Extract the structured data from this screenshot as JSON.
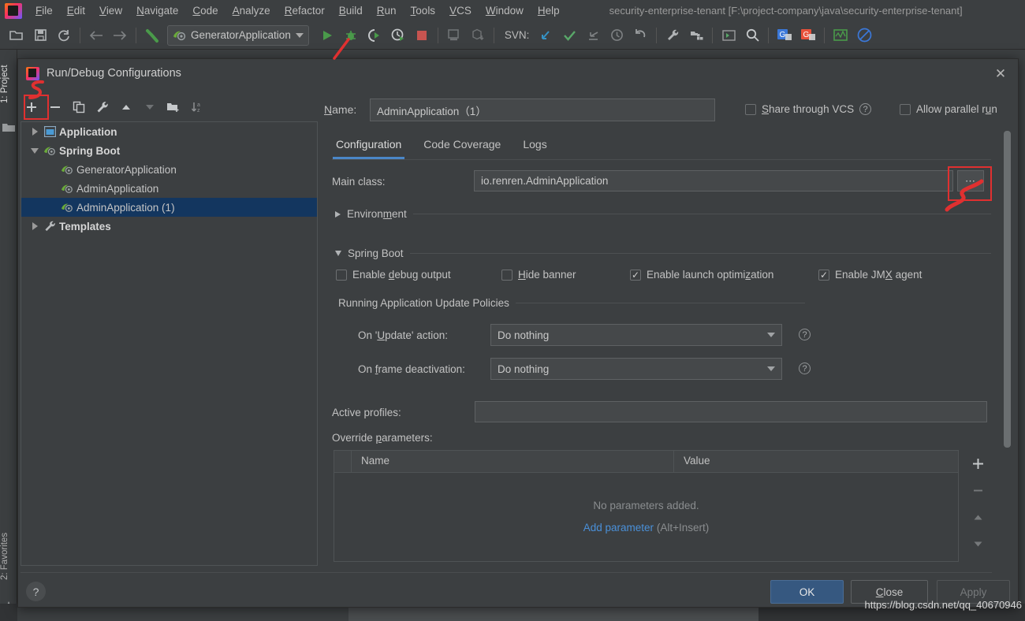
{
  "ide": {
    "menu": [
      {
        "label": "File",
        "accel": "F"
      },
      {
        "label": "Edit",
        "accel": "E"
      },
      {
        "label": "View",
        "accel": "V"
      },
      {
        "label": "Navigate",
        "accel": "N"
      },
      {
        "label": "Code",
        "accel": "C"
      },
      {
        "label": "Analyze",
        "accel": "A"
      },
      {
        "label": "Refactor",
        "accel": "R"
      },
      {
        "label": "Build",
        "accel": "B"
      },
      {
        "label": "Run",
        "accel": "R"
      },
      {
        "label": "Tools",
        "accel": "T"
      },
      {
        "label": "VCS",
        "accel": "V"
      },
      {
        "label": "Window",
        "accel": "W"
      },
      {
        "label": "Help",
        "accel": "H"
      }
    ],
    "project_title": "security-enterprise-tenant [F:\\project-company\\java\\security-enterprise-tenant]",
    "toolbar": {
      "run_configuration": "GeneratorApplication",
      "vcs_label": "SVN:"
    },
    "tool_windows": {
      "project": "1: Project",
      "favorites": "2: Favorites"
    }
  },
  "dialog": {
    "title": "Run/Debug Configurations",
    "close_label": "✕",
    "left_toolbar": [
      {
        "name": "add",
        "glyph": "+"
      },
      {
        "name": "remove",
        "glyph": "−"
      },
      {
        "name": "copy",
        "glyph": "copy"
      },
      {
        "name": "edit-templates",
        "glyph": "wrench"
      },
      {
        "name": "move-up",
        "glyph": "▲"
      },
      {
        "name": "move-down",
        "glyph": "▼"
      },
      {
        "name": "create-folder",
        "glyph": "folder-plus"
      },
      {
        "name": "sort",
        "glyph": "sort-az"
      }
    ],
    "tree": [
      {
        "label": "Application",
        "level": 0,
        "twisty": "right",
        "icon": "application",
        "bold": true,
        "selected": false
      },
      {
        "label": "Spring Boot",
        "level": 0,
        "twisty": "down",
        "icon": "spring",
        "bold": true,
        "selected": false
      },
      {
        "label": "GeneratorApplication",
        "level": 1,
        "twisty": "none",
        "icon": "spring",
        "bold": false,
        "selected": false
      },
      {
        "label": "AdminApplication",
        "level": 1,
        "twisty": "none",
        "icon": "spring",
        "bold": false,
        "selected": false
      },
      {
        "label": "AdminApplication  (1)",
        "level": 1,
        "twisty": "none",
        "icon": "spring",
        "bold": false,
        "selected": true
      },
      {
        "label": "Templates",
        "level": 0,
        "twisty": "right",
        "icon": "wrench",
        "bold": true,
        "selected": false
      }
    ],
    "name_label": "Name:",
    "name_accel": "N",
    "name_value": "AdminApplication（1）",
    "share_vcs": {
      "label": "Share through VCS",
      "accel": "S",
      "checked": false
    },
    "allow_parallel": {
      "label": "Allow parallel run",
      "accel": "u",
      "checked": false
    },
    "tabs": [
      {
        "label": "Configuration",
        "active": true
      },
      {
        "label": "Code Coverage",
        "active": false
      },
      {
        "label": "Logs",
        "active": false
      }
    ],
    "main_class": {
      "label": "Main class:",
      "value": "io.renren.AdminApplication",
      "browse_glyph": "⋯"
    },
    "environment_section": {
      "label": "Environment",
      "accel": "m",
      "expanded": false
    },
    "spring_boot_section": {
      "label": "Spring Boot",
      "accel": "g",
      "expanded": true
    },
    "spring_checkboxes": [
      {
        "label": "Enable debug output",
        "accel": "d",
        "checked": false
      },
      {
        "label": "Hide banner",
        "accel": "H",
        "checked": false
      },
      {
        "label": "Enable launch optimization",
        "accel": "z",
        "checked": true
      },
      {
        "label": "Enable JMX agent",
        "accel": "X",
        "checked": true
      }
    ],
    "update_policies_label": "Running Application Update Policies",
    "on_update_action": {
      "label": "On 'Update' action:",
      "accel": "U",
      "value": "Do nothing"
    },
    "on_frame_deactivation": {
      "label": "On frame deactivation:",
      "accel": "f",
      "value": "Do nothing"
    },
    "active_profiles": {
      "label": "Active profiles:",
      "value": ""
    },
    "override_parameters": {
      "label": "Override parameters:",
      "accel": "p",
      "columns": [
        "Name",
        "Value"
      ],
      "rows": [],
      "empty_message": "No parameters added.",
      "add_link": "Add parameter",
      "add_hint": "(Alt+Insert)",
      "side_buttons": [
        "+",
        "−",
        "▲",
        "▼"
      ]
    },
    "footer": {
      "help_glyph": "?",
      "ok": "OK",
      "close": "Close",
      "close_accel": "C",
      "apply": "Apply"
    }
  },
  "watermark": "https://blog.csdn.net/qq_40670946",
  "colors": {
    "accent_blue": "#4b87c8",
    "selection_blue": "#13365f",
    "primary_button": "#365880",
    "link_blue": "#4a90d9",
    "annotation_red": "#e03030",
    "panel_bg": "#3c3f41",
    "field_bg": "#45484a"
  }
}
